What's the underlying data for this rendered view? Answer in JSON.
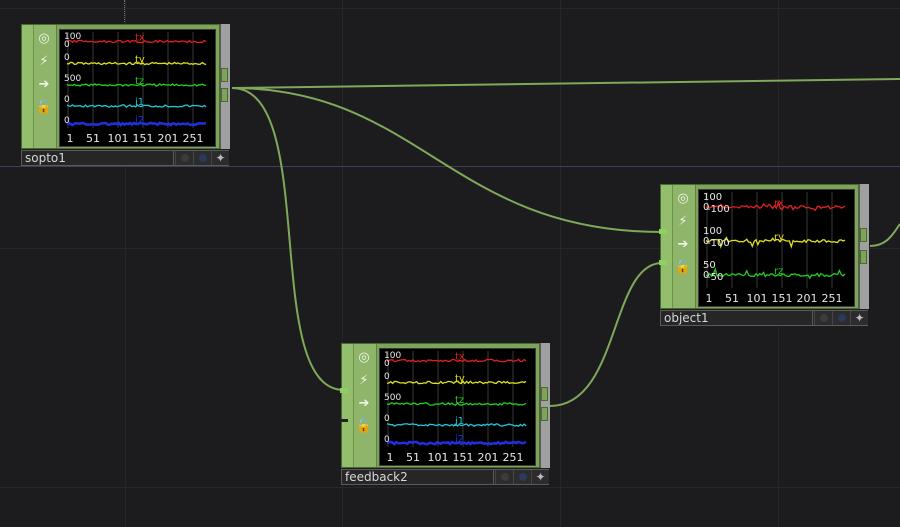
{
  "colors": {
    "background": "#1c1c1e",
    "node_green": "#7da45a",
    "wire": "#7fa85a",
    "chan_tx": "#e02020",
    "chan_ty": "#e0e020",
    "chan_tz": "#20d020",
    "chan_j1": "#20c8d8",
    "chan_j2": "#2030e0"
  },
  "toolbar_icons": [
    "bypass-icon",
    "viewer-icon",
    "display-icon",
    "lock-icon"
  ],
  "nodes": {
    "sopto1": {
      "name": "sopto1",
      "channels": [
        {
          "label": "tx",
          "top": "100",
          "bottom": "0",
          "color": "#e02020"
        },
        {
          "label": "ty",
          "top": "0",
          "bottom": "",
          "color": "#e0e020"
        },
        {
          "label": "tz",
          "top": "500",
          "bottom": "",
          "color": "#20d020"
        },
        {
          "label": "j1",
          "top": "0",
          "bottom": "",
          "color": "#20c8d8"
        },
        {
          "label": "j2",
          "top": "0",
          "bottom": "",
          "color": "#2030e0"
        }
      ],
      "x_ticks": [
        "1",
        "51",
        "101",
        "151",
        "201",
        "251"
      ]
    },
    "feedback2": {
      "name": "feedback2",
      "channels": [
        {
          "label": "tx",
          "top": "100",
          "bottom": "0",
          "color": "#e02020"
        },
        {
          "label": "ty",
          "top": "0",
          "bottom": "",
          "color": "#e0e020"
        },
        {
          "label": "tz",
          "top": "500",
          "bottom": "",
          "color": "#20d020"
        },
        {
          "label": "j1",
          "top": "0",
          "bottom": "",
          "color": "#20c8d8"
        },
        {
          "label": "j2",
          "top": "0",
          "bottom": "",
          "color": "#2030e0"
        }
      ],
      "x_ticks": [
        "1",
        "51",
        "101",
        "151",
        "201",
        "251"
      ]
    },
    "object1": {
      "name": "object1",
      "channels": [
        {
          "label": "rx",
          "top": "100",
          "mid": "0",
          "bottom": "-100",
          "color": "#e02020"
        },
        {
          "label": "ry",
          "top": "100",
          "mid": "0",
          "bottom": "-100",
          "color": "#e0e020"
        },
        {
          "label": "rz",
          "top": "50",
          "mid": "0",
          "bottom": "-50",
          "color": "#20d020"
        }
      ],
      "x_ticks": [
        "1",
        "51",
        "101",
        "151",
        "201",
        "251"
      ]
    }
  }
}
